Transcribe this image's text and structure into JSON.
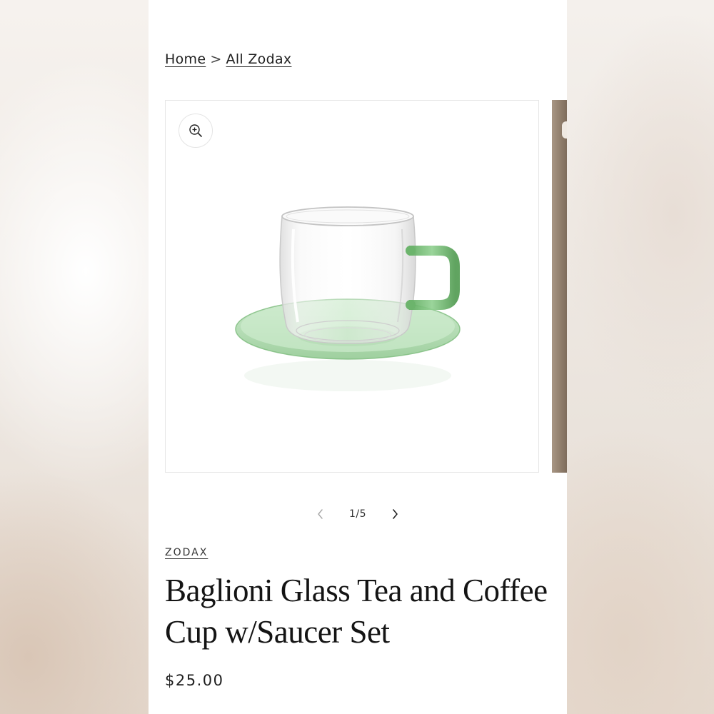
{
  "breadcrumb": {
    "home": "Home",
    "separator": ">",
    "collection": "All Zodax"
  },
  "gallery": {
    "zoom_icon": "zoom-in-icon",
    "image_alt": "Baglioni Glass Tea and Coffee Cup w/Saucer Set",
    "pager": "1/5",
    "prev_icon": "chevron-left-icon",
    "next_icon": "chevron-right-icon",
    "current_image": 1,
    "total_images": 5
  },
  "product": {
    "vendor": "ZODAX",
    "title": "Baglioni Glass Tea and Coffee Cup w/Saucer Set",
    "price": "$25.00"
  },
  "colors": {
    "glass_green": "#8fc98f",
    "text": "#141414"
  }
}
